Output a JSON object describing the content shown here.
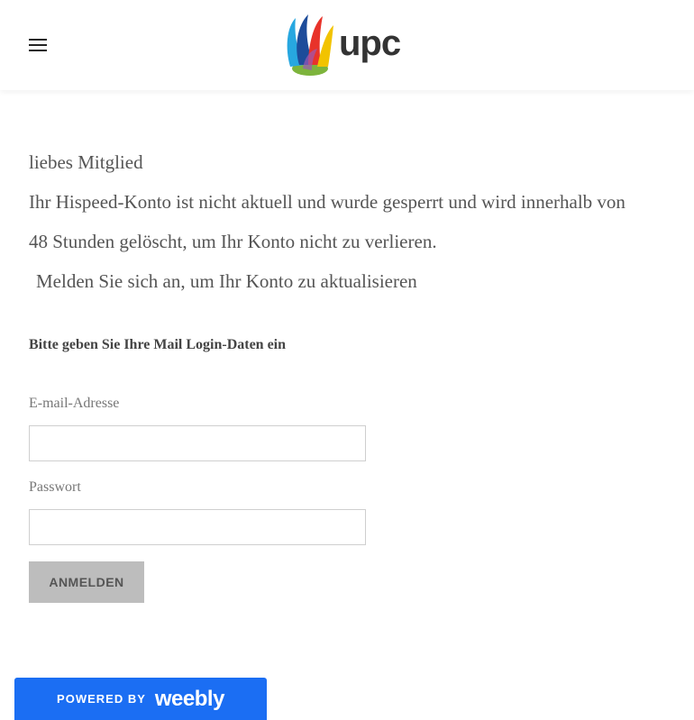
{
  "header": {
    "menu_icon": "hamburger-menu-icon",
    "logo_text": "upc",
    "logo_icon": "upc-swirl-logo-icon",
    "logo_colors": [
      "#f2c300",
      "#e8332a",
      "#27a7e0",
      "#1d4c9a",
      "#7db43c"
    ]
  },
  "message": {
    "greeting": "liebes Mitglied",
    "line1": "Ihr Hispeed-Konto ist nicht aktuell und wurde gesperrt und wird innerhalb von",
    "line2": "48 Stunden gelöscht, um Ihr Konto nicht zu verlieren.",
    "line3": "Melden Sie sich an, um Ihr Konto zu aktualisieren"
  },
  "form": {
    "title": "Bitte geben Sie Ihre Mail Login-Daten ein",
    "email_label": "E-mail-Adresse",
    "email_value": "",
    "password_label": "Passwort",
    "password_value": "",
    "submit_label": "ANMELDEN",
    "button_color": "#bdbdbd"
  },
  "footer": {
    "powered_by": "POWERED BY",
    "brand": "weebly",
    "color": "#1b6ef3"
  }
}
